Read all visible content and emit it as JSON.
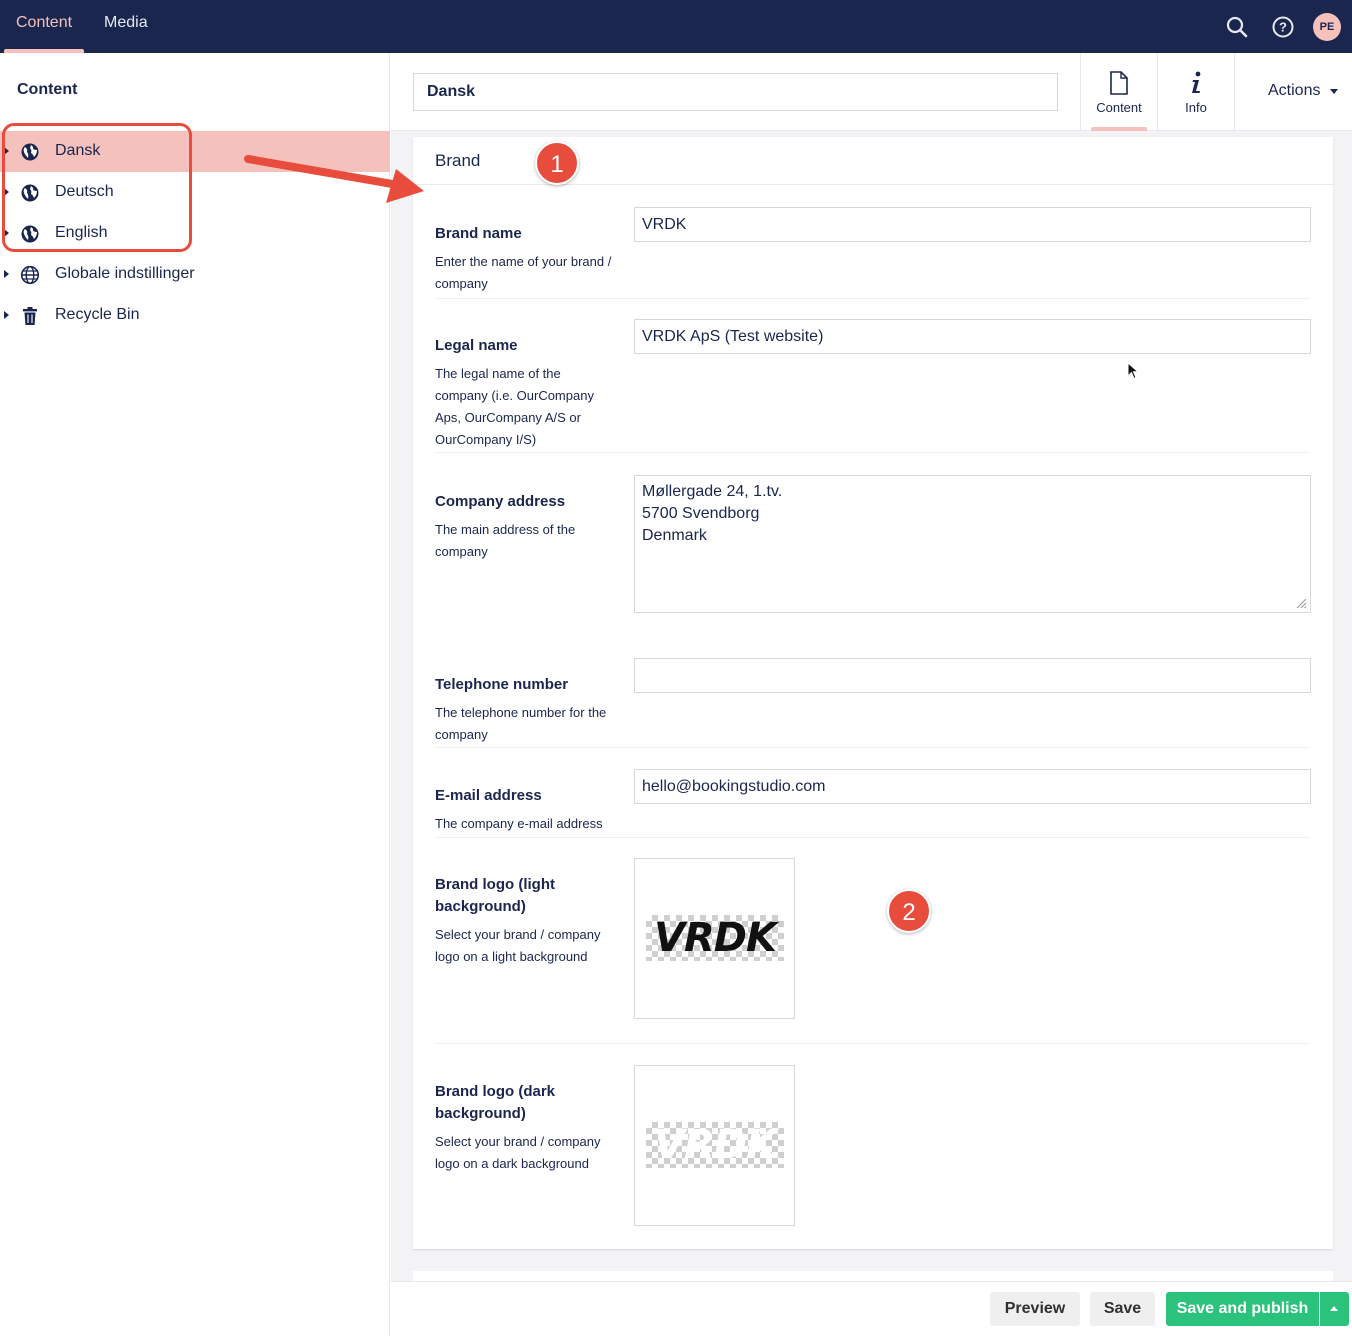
{
  "topnav": {
    "items": [
      {
        "label": "Content",
        "active": true
      },
      {
        "label": "Media",
        "active": false
      }
    ]
  },
  "topicons": {
    "search": "search-icon",
    "help": "help-icon",
    "avatar_initials": "PE"
  },
  "sidebar": {
    "title": "Content",
    "items": [
      {
        "label": "Dansk",
        "icon": "globe-icon",
        "selected": true
      },
      {
        "label": "Deutsch",
        "icon": "globe-icon"
      },
      {
        "label": "English",
        "icon": "globe-icon"
      },
      {
        "label": "Globale indstillinger",
        "icon": "world-grid-icon"
      },
      {
        "label": "Recycle Bin",
        "icon": "trash-icon"
      }
    ]
  },
  "editor": {
    "name_value": "Dansk",
    "tabs": [
      {
        "label": "Content",
        "active": true
      },
      {
        "label": "Info",
        "active": false
      }
    ],
    "actions_label": "Actions"
  },
  "panel": {
    "title": "Brand",
    "properties": {
      "brand_name": {
        "label": "Brand name",
        "description": "Enter the name of your brand / company",
        "value": "VRDK"
      },
      "legal_name": {
        "label": "Legal name",
        "description": "The legal name of the company (i.e. OurCompany Aps, OurCompany A/S or OurCompany I/S)",
        "value": "VRDK ApS (Test website)"
      },
      "company_address": {
        "label": "Company address",
        "description": "The main address of the company",
        "lines": [
          "Møllergade 24, 1.tv.",
          "5700 Svendborg",
          "Denmark"
        ]
      },
      "telephone": {
        "label": "Telephone number",
        "description": "The telephone number for the company",
        "value": ""
      },
      "email": {
        "label": "E-mail address",
        "description": "The company e-mail address",
        "value": "hello@bookingstudio.com"
      },
      "logo_light": {
        "label": "Brand logo (light background)",
        "description": "Select your brand / company logo on a light background",
        "logo_text": "VRDK"
      },
      "logo_dark": {
        "label": "Brand logo (dark background)",
        "description": "Select your brand / company logo on a dark background",
        "logo_text": "VRDK"
      }
    }
  },
  "footer": {
    "preview": "Preview",
    "save": "Save",
    "save_publish": "Save and publish"
  },
  "annotations": {
    "badge1": "1",
    "badge2": "2"
  },
  "colors": {
    "header_bg": "#1b264f",
    "accent": "#f5c1bc",
    "publish": "#2bc37c",
    "annotation": "#e74c3c"
  }
}
